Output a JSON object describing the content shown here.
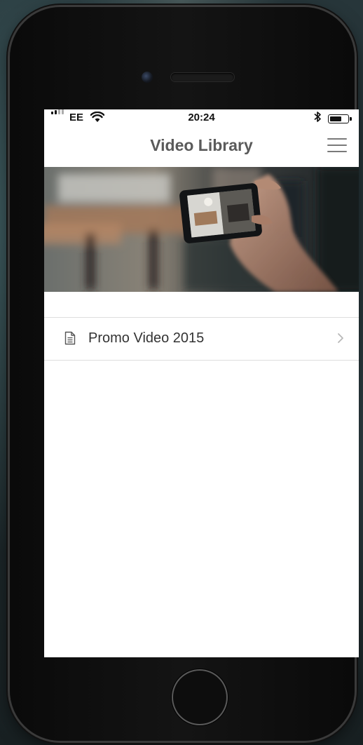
{
  "status_bar": {
    "carrier": "EE",
    "time": "20:24",
    "bluetooth_icon": "bluetooth-icon",
    "wifi_icon": "wifi-icon",
    "battery_level": 0.6
  },
  "nav": {
    "title": "Video Library",
    "menu_icon": "hamburger-menu-icon"
  },
  "hero": {
    "image": "hand holding smartphone recording a blurred cafe scene"
  },
  "list": {
    "items": [
      {
        "label": "Promo Video 2015",
        "icon": "document-icon",
        "trailing_icon": "chevron-right-icon"
      }
    ]
  },
  "colors": {
    "title": "#5a5a5a",
    "divider": "#dedede",
    "chevron": "#b8b8b8"
  }
}
